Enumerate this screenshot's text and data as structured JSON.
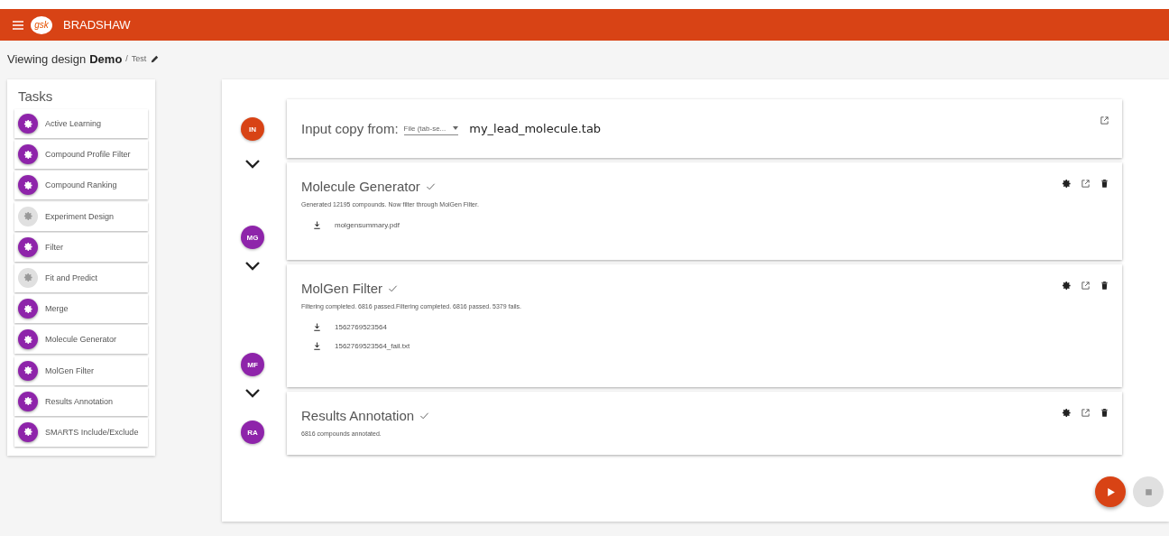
{
  "app_bar": {
    "title": "BRADSHAW",
    "logo_text": "gsk"
  },
  "breadcrumb": {
    "prefix": "Viewing design",
    "design": "Demo",
    "separator": "/",
    "sub": "Test"
  },
  "tasks": {
    "title": "Tasks",
    "items": [
      {
        "label": "Active Learning",
        "enabled": true
      },
      {
        "label": "Compound Profile Filter",
        "enabled": true
      },
      {
        "label": "Compound Ranking",
        "enabled": true
      },
      {
        "label": "Experiment Design",
        "enabled": false
      },
      {
        "label": "Filter",
        "enabled": true
      },
      {
        "label": "Fit and Predict",
        "enabled": false
      },
      {
        "label": "Merge",
        "enabled": true
      },
      {
        "label": "Molecule Generator",
        "enabled": true
      },
      {
        "label": "MolGen Filter",
        "enabled": true
      },
      {
        "label": "Results Annotation",
        "enabled": true
      },
      {
        "label": "SMARTS Include/Exclude",
        "enabled": true
      }
    ]
  },
  "steps": [
    {
      "kind": "input",
      "badge": "IN",
      "color": "#d84315",
      "label": "Input copy from:",
      "source": "File (tab-se...",
      "value": "my_lead_molecule.tab"
    },
    {
      "kind": "task",
      "badge": "MG",
      "color": "#8e24aa",
      "title": "Molecule Generator",
      "done": true,
      "message": "Generated 12195 compounds. Now filter through MolGen Filter.",
      "files": [
        "molgensummary.pdf"
      ]
    },
    {
      "kind": "task",
      "badge": "MF",
      "color": "#8e24aa",
      "title": "MolGen Filter",
      "done": true,
      "message": "Filtering completed. 6816 passed.Filtering completed. 6816 passed. 5379 fails.",
      "files": [
        "1562769523564",
        "1562769523564_fail.txt"
      ]
    },
    {
      "kind": "task",
      "badge": "RA",
      "color": "#8e24aa",
      "title": "Results Annotation",
      "done": true,
      "message": "6816 compounds annotated."
    }
  ]
}
